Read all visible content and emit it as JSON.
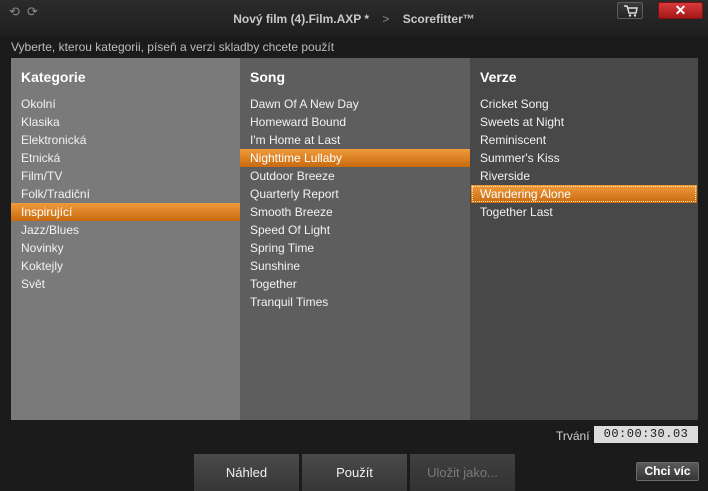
{
  "titlebar": {
    "project": "Nový film (4).Film.AXP",
    "modified_mark": " *",
    "separator": ">",
    "app": "Scorefitter™",
    "close_label": "✕"
  },
  "instructions": "Vyberte, kterou kategorii, píseň a verzi skladby chcete použít",
  "kategorie": {
    "header": "Kategorie",
    "items": [
      "Okolní",
      "Klasika",
      "Elektronická",
      "Etnická",
      "Film/TV",
      "Folk/Tradiční",
      "Inspirující",
      "Jazz/Blues",
      "Novinky",
      "Koktejly",
      "Svět"
    ],
    "selected": "Inspirující"
  },
  "song": {
    "header": "Song",
    "items": [
      "Dawn Of A New Day",
      "Homeward Bound",
      "I'm Home at Last",
      "Nighttime Lullaby",
      "Outdoor Breeze",
      "Quarterly Report",
      "Smooth Breeze",
      "Speed Of Light",
      "Spring Time",
      "Sunshine",
      "Together",
      "Tranquil Times"
    ],
    "selected": "Nighttime Lullaby"
  },
  "verze": {
    "header": "Verze",
    "items": [
      "Cricket Song",
      "Sweets at Night",
      "Reminiscent",
      "Summer's Kiss",
      "Riverside",
      "Wandering Alone",
      "Together Last"
    ],
    "selected": "Wandering Alone"
  },
  "duration": {
    "label": "Trvání",
    "value": "00:00:30.03"
  },
  "buttons": {
    "preview": "Náhled",
    "apply": "Použít",
    "save_as": "Uložit jako...",
    "more": "Chci víc"
  },
  "colors": {
    "selection": "#e08a2a",
    "accent_close": "#c42424"
  }
}
